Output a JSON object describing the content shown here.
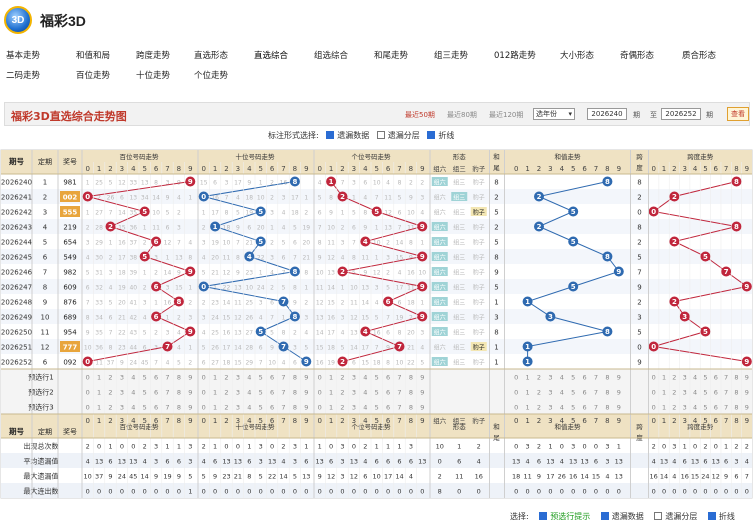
{
  "app": {
    "title": "福彩3D",
    "logo": "3D"
  },
  "nav": [
    [
      "基本走势",
      "和值和局",
      "跨度走势",
      "直选形态",
      "直选综合",
      "组选综合",
      "和尾走势",
      "组三走势",
      "012路走势",
      "大小形态",
      "奇偶形态",
      "质合形态"
    ],
    [
      "二码走势",
      "百位走势",
      "十位走势",
      "个位走势"
    ]
  ],
  "active_nav": "直选综合",
  "chart_title": "福彩3D直选综合走势图",
  "periods": {
    "recent50": "最近50期",
    "recent80": "最近80期",
    "recent120": "最近120期",
    "year_select": "选年份",
    "from": "2026240",
    "to": "2026252",
    "unit": "期",
    "to_label": "至",
    "query": "查看"
  },
  "options": {
    "label": "标注形式选择:",
    "missing": "遗漏数据",
    "layer": "遗漏分层",
    "polyline": "折线"
  },
  "headers": {
    "issue": "期号",
    "order": "定期",
    "prize": "奖号",
    "hundred": "百位号码走势",
    "ten": "十位号码走势",
    "unit": "个位号码走势",
    "form": "形态",
    "sumtail": "和尾",
    "sum": "和值走势",
    "span": "跨度",
    "spantrend": "跨度走势",
    "form_cols": [
      "组六",
      "组三",
      "豹子"
    ],
    "tail_a": "和",
    "tail_b": "尾",
    "span_a": "跨",
    "span_b": "度"
  },
  "digits": [
    "0",
    "1",
    "2",
    "3",
    "4",
    "5",
    "6",
    "7",
    "8",
    "9"
  ],
  "rows": [
    {
      "issue": "2026240",
      "order": "1",
      "prize": "981",
      "h": 9,
      "t": 8,
      "u": 1,
      "form": "组六",
      "tail": "8",
      "span": 8,
      "hmiss": [
        "1",
        "25",
        "5",
        "12",
        "33",
        "13",
        "8",
        "3",
        "9"
      ],
      "tmiss": [
        "15",
        "6",
        "3",
        "17",
        "9",
        "1",
        "2",
        "16"
      ],
      "umiss": [
        "4",
        "7",
        "3",
        "6",
        "10",
        "4",
        "8",
        "2",
        "2"
      ]
    },
    {
      "issue": "2026241",
      "order": "2",
      "prize": "002",
      "h": 0,
      "t": 0,
      "u": 2,
      "form": "组三",
      "tail": "2",
      "span": 2,
      "hmiss": [
        "2",
        "26",
        "6",
        "13",
        "34",
        "14",
        "9",
        "4",
        "1"
      ],
      "tmiss": [
        "16",
        "7",
        "4",
        "18",
        "10",
        "2",
        "3",
        "17",
        "1"
      ],
      "umiss": [
        "5",
        "8",
        "1",
        "4",
        "7",
        "11",
        "5",
        "9",
        "3"
      ]
    },
    {
      "issue": "2026242",
      "order": "3",
      "prize": "555",
      "h": 5,
      "t": 5,
      "u": 5,
      "form": "豹子",
      "tail": "5",
      "span": 0,
      "hmiss": [
        "1",
        "27",
        "7",
        "14",
        "35",
        "10",
        "5",
        "2"
      ],
      "tmiss": [
        "1",
        "17",
        "8",
        "5",
        "19",
        "3",
        "4",
        "18",
        "2"
      ],
      "umiss": [
        "6",
        "9",
        "1",
        "5",
        "8",
        "12",
        "6",
        "10",
        "4"
      ]
    },
    {
      "issue": "2026243",
      "order": "4",
      "prize": "219",
      "h": 2,
      "t": 1,
      "u": 9,
      "form": "组六",
      "tail": "2",
      "span": 8,
      "hmiss": [
        "2",
        "28",
        "15",
        "36",
        "1",
        "11",
        "6",
        "3"
      ],
      "tmiss": [
        "2",
        "18",
        "9",
        "6",
        "20",
        "1",
        "4",
        "5",
        "19"
      ],
      "umiss": [
        "7",
        "10",
        "2",
        "6",
        "9",
        "1",
        "13",
        "7",
        "11"
      ]
    },
    {
      "issue": "2026244",
      "order": "5",
      "prize": "654",
      "h": 6,
      "t": 5,
      "u": 4,
      "form": "组六",
      "tail": "5",
      "span": 2,
      "hmiss": [
        "3",
        "29",
        "1",
        "16",
        "37",
        "2",
        "12",
        "7",
        "4"
      ],
      "tmiss": [
        "3",
        "19",
        "10",
        "7",
        "21",
        "2",
        "5",
        "6",
        "20"
      ],
      "umiss": [
        "8",
        "11",
        "3",
        "7",
        "10",
        "2",
        "14",
        "8",
        "1"
      ]
    },
    {
      "issue": "2026245",
      "order": "6",
      "prize": "549",
      "h": 5,
      "t": 4,
      "u": 9,
      "form": "组六",
      "tail": "8",
      "span": 5,
      "hmiss": [
        "4",
        "30",
        "2",
        "17",
        "38",
        "3",
        "1",
        "13",
        "8"
      ],
      "tmiss": [
        "4",
        "20",
        "11",
        "8",
        "22",
        "3",
        "6",
        "7",
        "21"
      ],
      "umiss": [
        "9",
        "12",
        "4",
        "8",
        "11",
        "1",
        "3",
        "15",
        "9"
      ]
    },
    {
      "issue": "2026246",
      "order": "7",
      "prize": "982",
      "h": 9,
      "t": 8,
      "u": 2,
      "form": "组六",
      "tail": "9",
      "span": 7,
      "hmiss": [
        "5",
        "31",
        "3",
        "18",
        "39",
        "1",
        "2",
        "14",
        "9"
      ],
      "tmiss": [
        "5",
        "21",
        "12",
        "9",
        "23",
        "1",
        "4",
        "7",
        "8"
      ],
      "umiss": [
        "10",
        "13",
        "5",
        "9",
        "12",
        "2",
        "4",
        "16",
        "10"
      ]
    },
    {
      "issue": "2026247",
      "order": "8",
      "prize": "609",
      "h": 6,
      "t": 0,
      "u": 9,
      "form": "组六",
      "tail": "5",
      "span": 9,
      "hmiss": [
        "6",
        "32",
        "4",
        "19",
        "40",
        "2",
        "3",
        "15",
        "1"
      ],
      "tmiss": [
        "1",
        "22",
        "13",
        "10",
        "24",
        "2",
        "5",
        "8",
        "1"
      ],
      "umiss": [
        "11",
        "14",
        "1",
        "10",
        "13",
        "3",
        "5",
        "17",
        "11"
      ]
    },
    {
      "issue": "2026248",
      "order": "9",
      "prize": "876",
      "h": 8,
      "t": 7,
      "u": 6,
      "form": "组六",
      "tail": "1",
      "span": 2,
      "hmiss": [
        "7",
        "33",
        "5",
        "20",
        "41",
        "3",
        "1",
        "16",
        "2"
      ],
      "tmiss": [
        "2",
        "23",
        "14",
        "11",
        "25",
        "3",
        "6",
        "9",
        "2"
      ],
      "umiss": [
        "12",
        "15",
        "2",
        "11",
        "14",
        "4",
        "6",
        "18",
        "1"
      ]
    },
    {
      "issue": "2026249",
      "order": "10",
      "prize": "689",
      "h": 6,
      "t": 8,
      "u": 9,
      "form": "组六",
      "tail": "3",
      "span": 3,
      "hmiss": [
        "8",
        "34",
        "6",
        "21",
        "42",
        "4",
        "1",
        "2",
        "3"
      ],
      "tmiss": [
        "3",
        "24",
        "15",
        "12",
        "26",
        "4",
        "7",
        "1",
        "3"
      ],
      "umiss": [
        "13",
        "16",
        "3",
        "12",
        "15",
        "5",
        "7",
        "19",
        "2"
      ]
    },
    {
      "issue": "2026250",
      "order": "11",
      "prize": "954",
      "h": 9,
      "t": 5,
      "u": 4,
      "form": "组六",
      "tail": "8",
      "span": 5,
      "hmiss": [
        "9",
        "35",
        "7",
        "22",
        "43",
        "5",
        "2",
        "3",
        "4"
      ],
      "tmiss": [
        "4",
        "25",
        "16",
        "13",
        "27",
        "5",
        "8",
        "2",
        "4"
      ],
      "umiss": [
        "14",
        "17",
        "4",
        "13",
        "16",
        "6",
        "8",
        "20",
        "3"
      ]
    },
    {
      "issue": "2026251",
      "order": "12",
      "prize": "777",
      "h": 7,
      "t": 7,
      "u": 7,
      "form": "豹子",
      "tail": "1",
      "span": 0,
      "hmiss": [
        "10",
        "36",
        "8",
        "23",
        "44",
        "6",
        "3",
        "4",
        "1"
      ],
      "tmiss": [
        "5",
        "26",
        "17",
        "14",
        "28",
        "6",
        "9",
        "3",
        "5"
      ],
      "umiss": [
        "15",
        "18",
        "5",
        "14",
        "17",
        "7",
        "9",
        "21",
        "4"
      ]
    },
    {
      "issue": "2026252",
      "order": "6",
      "prize": "092",
      "h": 0,
      "t": 9,
      "u": 2,
      "form": "组六",
      "tail": "1",
      "span": 9,
      "hmiss": [
        "11",
        "37",
        "9",
        "24",
        "45",
        "7",
        "4",
        "5",
        "2"
      ],
      "tmiss": [
        "6",
        "27",
        "18",
        "15",
        "29",
        "7",
        "10",
        "4",
        "6"
      ],
      "umiss": [
        "16",
        "19",
        "6",
        "15",
        "18",
        "8",
        "10",
        "22",
        "5"
      ]
    }
  ],
  "predict": [
    "预选行1",
    "预选行2",
    "预选行3"
  ],
  "stats": [
    {
      "label": "出现总次数",
      "h": [
        "2",
        "0",
        "1",
        "0",
        "0",
        "2",
        "3",
        "1",
        "1",
        "3"
      ],
      "t": [
        "2",
        "1",
        "0",
        "0",
        "1",
        "3",
        "0",
        "2",
        "3",
        "1"
      ],
      "u": [
        "1",
        "0",
        "3",
        "0",
        "2",
        "1",
        "1",
        "1",
        "3"
      ],
      "form": [
        "10",
        "1",
        "2"
      ],
      "tail": "",
      "sum": [
        "0",
        "3",
        "2",
        "1",
        "0",
        "3",
        "0",
        "0",
        "3",
        "1"
      ],
      "span": [
        "2",
        "0",
        "3",
        "1",
        "0",
        "2",
        "0",
        "1",
        "2",
        "2"
      ]
    },
    {
      "label": "平均遗漏值",
      "h": [
        "4",
        "13",
        "6",
        "13",
        "13",
        "4",
        "3",
        "6",
        "6",
        "3"
      ],
      "t": [
        "4",
        "6",
        "13",
        "13",
        "6",
        "3",
        "13",
        "4",
        "3",
        "6"
      ],
      "u": [
        "13",
        "6",
        "3",
        "13",
        "4",
        "6",
        "6",
        "6",
        "6",
        "13"
      ],
      "form": [
        "0",
        "6",
        "4"
      ],
      "tail": "",
      "sum": [
        "13",
        "4",
        "6",
        "13",
        "4",
        "13",
        "13",
        "6",
        "3",
        "13"
      ],
      "span": [
        "4",
        "13",
        "4",
        "6",
        "13",
        "6",
        "13",
        "6",
        "3",
        "4"
      ]
    },
    {
      "label": "最大遗漏值",
      "h": [
        "10",
        "37",
        "9",
        "24",
        "45",
        "14",
        "9",
        "19",
        "9",
        "5"
      ],
      "t": [
        "5",
        "9",
        "23",
        "21",
        "8",
        "5",
        "22",
        "14",
        "5",
        "13"
      ],
      "u": [
        "9",
        "12",
        "3",
        "12",
        "6",
        "10",
        "17",
        "14",
        "4"
      ],
      "form": [
        "2",
        "11",
        "16"
      ],
      "tail": "",
      "sum": [
        "18",
        "11",
        "9",
        "17",
        "26",
        "16",
        "14",
        "15",
        "4",
        "13"
      ],
      "span": [
        "16",
        "14",
        "4",
        "16",
        "15",
        "24",
        "12",
        "9",
        "6",
        "7"
      ]
    },
    {
      "label": "最大连出数",
      "h": [
        "0",
        "0",
        "0",
        "0",
        "0",
        "0",
        "0",
        "0",
        "0",
        "1"
      ],
      "t": [
        "0",
        "0",
        "0",
        "0",
        "0",
        "0",
        "0",
        "0",
        "0",
        "0"
      ],
      "u": [
        "0",
        "0",
        "0",
        "0",
        "0",
        "0",
        "0",
        "0",
        "0",
        "0"
      ],
      "form": [
        "8",
        "0",
        "0"
      ],
      "tail": "",
      "sum": [
        "0",
        "0",
        "0",
        "0",
        "0",
        "0",
        "0",
        "0",
        "0",
        "0"
      ],
      "span": [
        "0",
        "0",
        "0",
        "0",
        "0",
        "0",
        "0",
        "0",
        "0",
        "0"
      ]
    }
  ],
  "bottom": {
    "label": "选择:",
    "predict": "预选行提示",
    "missing": "遗漏数据",
    "layer": "遗漏分层",
    "polyline": "折线"
  },
  "colors": {
    "red": "#c0263c",
    "blue": "#2f6ab0",
    "header": "#efe2c3",
    "rowA": "#ffffff",
    "rowB": "#f3f6fb",
    "dim": "#b9b9b9"
  }
}
